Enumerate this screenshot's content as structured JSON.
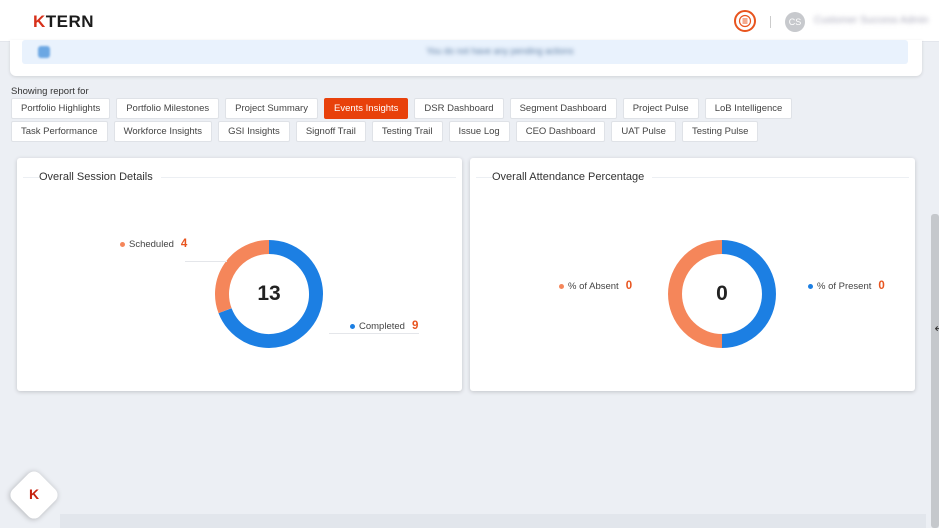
{
  "header": {
    "logo_text": "TERN",
    "logo_mark_icon": "ktern-k-logo",
    "avatar_initials": "CS",
    "user_name": "Customer Success Admin"
  },
  "notice": {
    "text": "You do not have any pending actions"
  },
  "report": {
    "showing_label": "Showing report for"
  },
  "tabs": [
    {
      "label": "Portfolio Highlights",
      "active": false
    },
    {
      "label": "Portfolio Milestones",
      "active": false
    },
    {
      "label": "Project Summary",
      "active": false
    },
    {
      "label": "Events Insights",
      "active": true
    },
    {
      "label": "DSR Dashboard",
      "active": false
    },
    {
      "label": "Segment Dashboard",
      "active": false
    },
    {
      "label": "Project Pulse",
      "active": false
    },
    {
      "label": "LoB Intelligence",
      "active": false
    },
    {
      "label": "Task Performance",
      "active": false
    },
    {
      "label": "Workforce Insights",
      "active": false
    },
    {
      "label": "GSI Insights",
      "active": false
    },
    {
      "label": "Signoff Trail",
      "active": false
    },
    {
      "label": "Testing Trail",
      "active": false
    },
    {
      "label": "Issue Log",
      "active": false
    },
    {
      "label": "CEO Dashboard",
      "active": false
    },
    {
      "label": "UAT Pulse",
      "active": false
    },
    {
      "label": "Testing Pulse",
      "active": false
    }
  ],
  "session_card": {
    "title": "Overall Session Details",
    "center_value": "13",
    "segments": [
      {
        "label": "Scheduled",
        "value": "4",
        "color": "#f5865a"
      },
      {
        "label": "Completed",
        "value": "9",
        "color": "#1c7fe3"
      }
    ]
  },
  "attendance_card": {
    "title": "Overall Attendance Percentage",
    "center_value": "0",
    "segments": [
      {
        "label": "% of Absent",
        "value": "0",
        "color": "#f5865a"
      },
      {
        "label": "% of Present",
        "value": "0",
        "color": "#1c7fe3"
      }
    ]
  },
  "colors": {
    "accent": "#e8410b",
    "orange": "#f5865a",
    "blue": "#1c7fe3"
  }
}
